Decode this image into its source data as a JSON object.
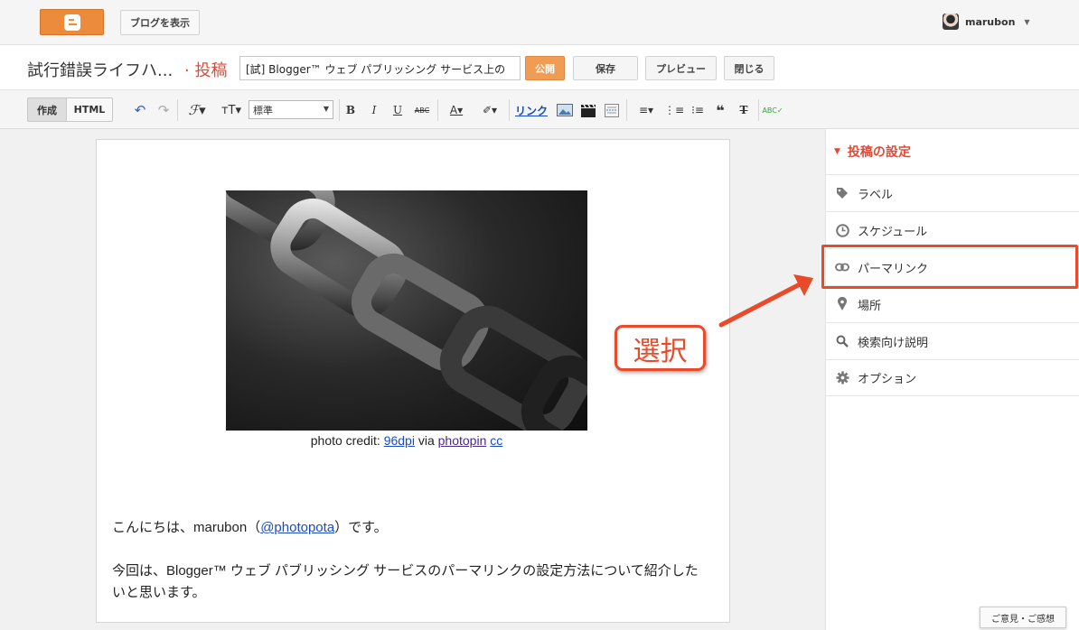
{
  "topbar": {
    "view_blog_label": "ブログを表示",
    "username": "marubon"
  },
  "header": {
    "blog_title": "試行錯誤ライフハ...",
    "section": "· 投稿",
    "post_title_value": "[試] Blogger™ ウェブ パブリッシング サービス上の",
    "publish_label": "公開",
    "save_label": "保存",
    "preview_label": "プレビュー",
    "close_label": "閉じる"
  },
  "toolbar": {
    "compose_label": "作成",
    "html_label": "HTML",
    "format_value": "標準",
    "link_label": "リンク",
    "icons": [
      "undo-icon",
      "redo-icon",
      "font-icon",
      "font-size-icon",
      "bold-icon",
      "italic-icon",
      "underline-icon",
      "strikethrough-icon",
      "text-color-icon",
      "highlight-icon",
      "image-icon",
      "video-icon",
      "jump-break-icon",
      "align-icon",
      "numbered-list-icon",
      "bullet-list-icon",
      "quote-icon",
      "clear-format-icon",
      "spellcheck-icon"
    ]
  },
  "editor": {
    "caption_prefix": "photo credit: ",
    "caption_link1": "96dpi",
    "caption_via": " via ",
    "caption_link2": "photopin",
    "caption_link3": "cc",
    "p1_before": "こんにちは、marubon（",
    "p1_link": "@photopota",
    "p1_after": "）です。",
    "p2": "今回は、Blogger™ ウェブ パブリッシング サービスのパーマリンクの設定方法について紹介したいと思います。"
  },
  "annotation": {
    "label": "選択",
    "color": "#e84a2a"
  },
  "sidebar": {
    "header": "投稿の設定",
    "items": [
      {
        "label": "ラベル",
        "icon": "tag-icon"
      },
      {
        "label": "スケジュール",
        "icon": "clock-icon"
      },
      {
        "label": "パーマリンク",
        "icon": "link-icon"
      },
      {
        "label": "場所",
        "icon": "pin-icon"
      },
      {
        "label": "検索向け説明",
        "icon": "search-icon"
      },
      {
        "label": "オプション",
        "icon": "gear-icon"
      }
    ]
  },
  "feedback_label": "ご意見・ご感想",
  "colors": {
    "accent": "#dd4b39",
    "publish": "#f09c55",
    "link": "#1a4ac2"
  }
}
